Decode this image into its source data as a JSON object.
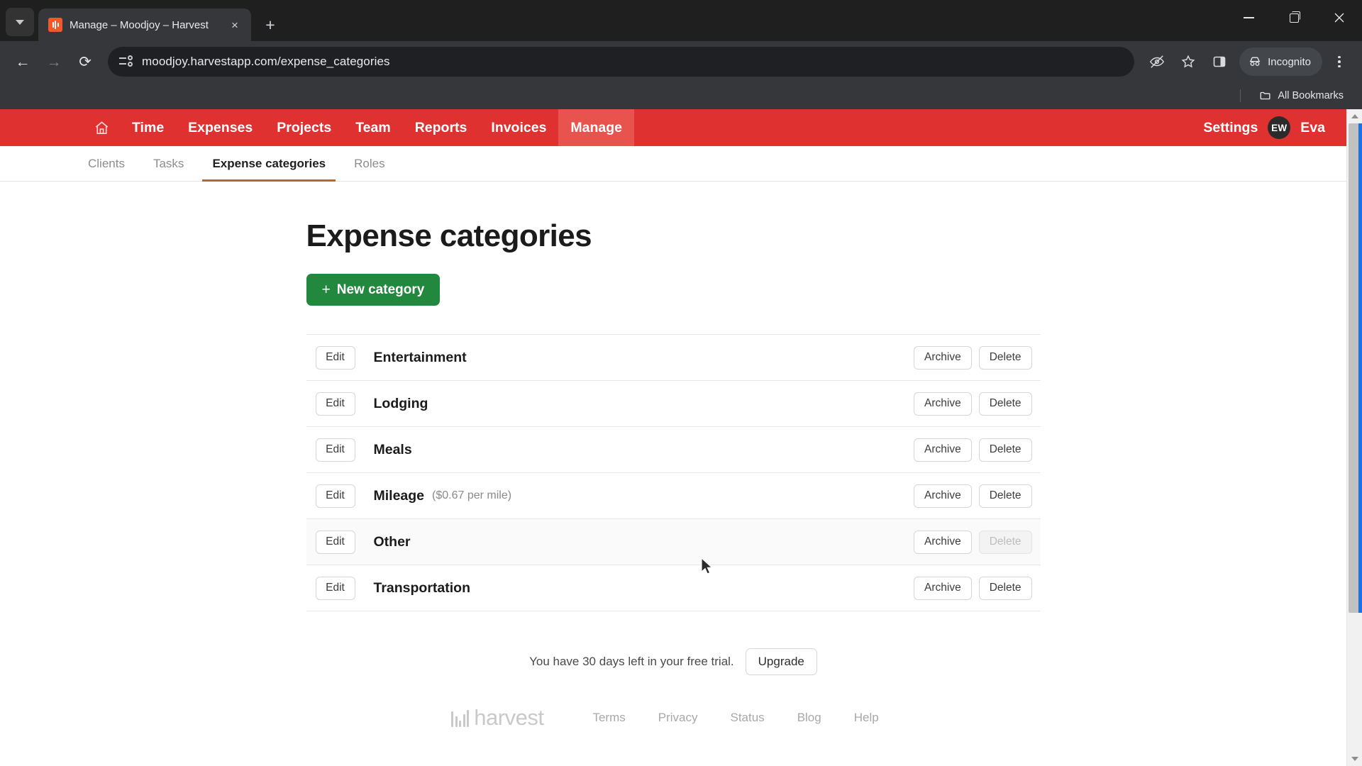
{
  "browser": {
    "tab": {
      "title": "Manage – Moodjoy – Harvest",
      "favicon": "harvest-favicon",
      "close": "×"
    },
    "newtab_label": "+",
    "url": "moodjoy.harvestapp.com/expense_categories",
    "incognito_label": "Incognito",
    "bookmarks_label": "All Bookmarks",
    "icons": {
      "back": "←",
      "forward": "→",
      "reload": "⟳",
      "tabsearch": "chevron-down",
      "eye_off": "hide-password-icon",
      "star": "☆",
      "side_panel": "side-panel-icon",
      "kebab": "three-dot-menu"
    }
  },
  "app": {
    "nav": {
      "home_label": "Home",
      "items": [
        {
          "label": "Time",
          "active": false
        },
        {
          "label": "Expenses",
          "active": false
        },
        {
          "label": "Projects",
          "active": false
        },
        {
          "label": "Team",
          "active": false
        },
        {
          "label": "Reports",
          "active": false
        },
        {
          "label": "Invoices",
          "active": false
        },
        {
          "label": "Manage",
          "active": true
        }
      ],
      "settings_label": "Settings",
      "avatar_initials": "EW",
      "user_name": "Eva",
      "bar_color": "#e03131",
      "active_color": "#e8534e"
    },
    "subnav": {
      "items": [
        {
          "label": "Clients",
          "active": false
        },
        {
          "label": "Tasks",
          "active": false
        },
        {
          "label": "Expense categories",
          "active": true
        },
        {
          "label": "Roles",
          "active": false
        }
      ],
      "active_underline_color": "#b9682a"
    },
    "page_title": "Expense categories",
    "new_button": {
      "plus": "+",
      "label": "New category",
      "color": "#21883e"
    },
    "row_buttons": {
      "edit": "Edit",
      "archive": "Archive",
      "delete": "Delete"
    },
    "categories": [
      {
        "name": "Entertainment",
        "rate": "",
        "delete_disabled": false,
        "hovered": false
      },
      {
        "name": "Lodging",
        "rate": "",
        "delete_disabled": false,
        "hovered": false
      },
      {
        "name": "Meals",
        "rate": "",
        "delete_disabled": false,
        "hovered": false
      },
      {
        "name": "Mileage",
        "rate": "($0.67 per mile)",
        "delete_disabled": false,
        "hovered": false
      },
      {
        "name": "Other",
        "rate": "",
        "delete_disabled": true,
        "hovered": true
      },
      {
        "name": "Transportation",
        "rate": "",
        "delete_disabled": false,
        "hovered": false
      }
    ],
    "trial": {
      "text": "You have 30 days left in your free trial.",
      "upgrade_label": "Upgrade"
    },
    "footer": {
      "logo_word": "harvest",
      "links": [
        "Terms",
        "Privacy",
        "Status",
        "Blog",
        "Help"
      ]
    }
  }
}
